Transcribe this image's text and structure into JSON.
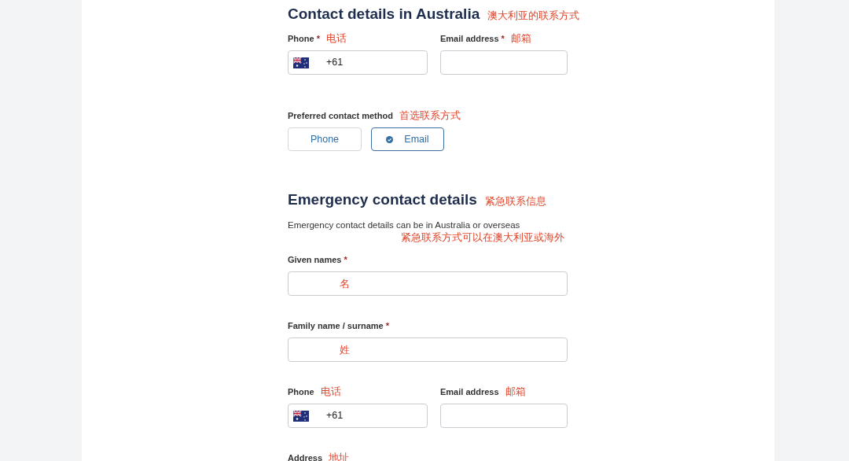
{
  "sections": [
    {
      "heading": "Contact details in Australia",
      "heading_note": "澳大利亚的联系方式",
      "rows": [
        {
          "fields": [
            {
              "kind": "phone",
              "label": "Phone",
              "required_mark": "*",
              "note": "电话",
              "value": "+61"
            },
            {
              "kind": "text",
              "label": "Email address",
              "required_mark": "*",
              "note": "邮箱"
            }
          ]
        },
        {
          "fields": [
            {
              "kind": "choice",
              "label": "Preferred contact method",
              "note": "首选联系方式",
              "options": [
                {
                  "label": "Phone",
                  "selected": false
                },
                {
                  "label": "Email",
                  "selected": true
                }
              ]
            }
          ]
        }
      ]
    },
    {
      "heading": "Emergency contact details",
      "heading_note": "紧急联系信息",
      "description": "Emergency contact details can be in Australia or overseas",
      "description_note": "紧急联系方式可以在澳大利亚或海外",
      "rows": [
        {
          "fields": [
            {
              "kind": "text",
              "label": "Given names",
              "required_mark": "*",
              "input_note": "名"
            }
          ]
        },
        {
          "fields": [
            {
              "kind": "text",
              "label": "Family name / surname",
              "required_mark": "*",
              "input_note": "姓"
            }
          ]
        },
        {
          "fields": [
            {
              "kind": "phone",
              "label": "Phone",
              "note": "电话",
              "value": "+61"
            },
            {
              "kind": "text",
              "label": "Email address",
              "note": "邮箱"
            }
          ]
        },
        {
          "fields": [
            {
              "kind": "label_only",
              "label": "Address",
              "note": "地址"
            }
          ]
        }
      ]
    }
  ]
}
